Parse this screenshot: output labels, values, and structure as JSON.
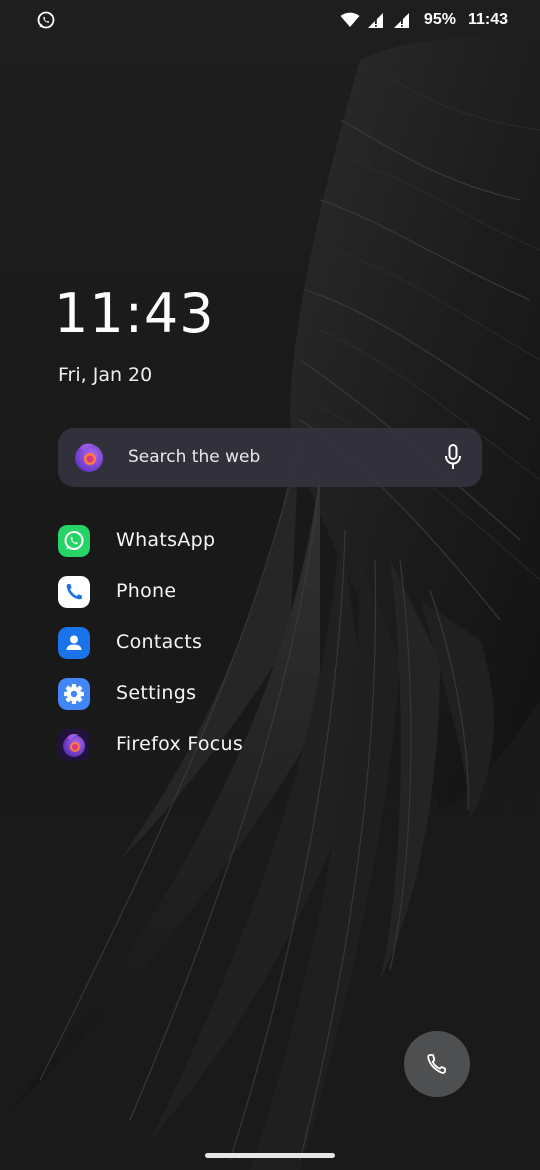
{
  "status_bar": {
    "notification_icon": "whatsapp-icon",
    "wifi_icon": "wifi-icon",
    "signal_icons": [
      "signal-1-icon",
      "signal-2-icon"
    ],
    "battery": "95%",
    "time": "11:43"
  },
  "clock": {
    "time": "11:43",
    "date": "Fri, Jan 20"
  },
  "search": {
    "placeholder": "Search the web",
    "logo_icon": "firefox-focus-icon",
    "mic_icon": "mic-icon"
  },
  "apps": [
    {
      "label": "WhatsApp",
      "icon": "whatsapp-icon",
      "color": "#25D366"
    },
    {
      "label": "Phone",
      "icon": "phone-icon",
      "color": "#ffffff"
    },
    {
      "label": "Contacts",
      "icon": "contacts-icon",
      "color": "#1a73e8"
    },
    {
      "label": "Settings",
      "icon": "settings-icon",
      "color": "#4285f4"
    },
    {
      "label": "Firefox Focus",
      "icon": "firefox-focus-icon",
      "color": "#7542e5"
    }
  ],
  "dock": {
    "dial_icon": "phone-icon"
  }
}
